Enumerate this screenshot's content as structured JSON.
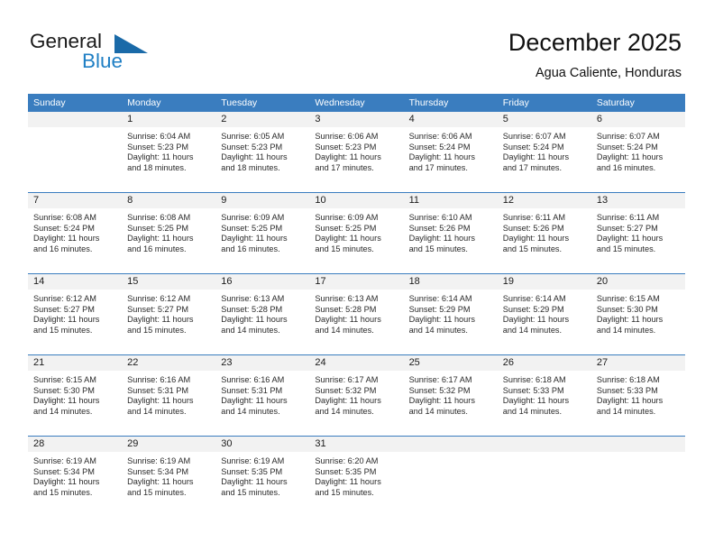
{
  "brand": {
    "word_one": "General",
    "word_two": "Blue",
    "triangle_icon": "triangle-logo-icon",
    "accent_color": "#1f7fc4",
    "triangle_color": "#1a6aa8"
  },
  "header": {
    "title": "December 2025",
    "subtitle": "Agua Caliente, Honduras"
  },
  "calendar": {
    "header_bg": "#3a7dbf",
    "daynum_bg": "#f2f2f2",
    "weekday_headers": [
      "Sunday",
      "Monday",
      "Tuesday",
      "Wednesday",
      "Thursday",
      "Friday",
      "Saturday"
    ],
    "weeks": [
      [
        {
          "day": "",
          "lines": []
        },
        {
          "day": "1",
          "lines": [
            "Sunrise: 6:04 AM",
            "Sunset: 5:23 PM",
            "Daylight: 11 hours",
            "and 18 minutes."
          ]
        },
        {
          "day": "2",
          "lines": [
            "Sunrise: 6:05 AM",
            "Sunset: 5:23 PM",
            "Daylight: 11 hours",
            "and 18 minutes."
          ]
        },
        {
          "day": "3",
          "lines": [
            "Sunrise: 6:06 AM",
            "Sunset: 5:23 PM",
            "Daylight: 11 hours",
            "and 17 minutes."
          ]
        },
        {
          "day": "4",
          "lines": [
            "Sunrise: 6:06 AM",
            "Sunset: 5:24 PM",
            "Daylight: 11 hours",
            "and 17 minutes."
          ]
        },
        {
          "day": "5",
          "lines": [
            "Sunrise: 6:07 AM",
            "Sunset: 5:24 PM",
            "Daylight: 11 hours",
            "and 17 minutes."
          ]
        },
        {
          "day": "6",
          "lines": [
            "Sunrise: 6:07 AM",
            "Sunset: 5:24 PM",
            "Daylight: 11 hours",
            "and 16 minutes."
          ]
        }
      ],
      [
        {
          "day": "7",
          "lines": [
            "Sunrise: 6:08 AM",
            "Sunset: 5:24 PM",
            "Daylight: 11 hours",
            "and 16 minutes."
          ]
        },
        {
          "day": "8",
          "lines": [
            "Sunrise: 6:08 AM",
            "Sunset: 5:25 PM",
            "Daylight: 11 hours",
            "and 16 minutes."
          ]
        },
        {
          "day": "9",
          "lines": [
            "Sunrise: 6:09 AM",
            "Sunset: 5:25 PM",
            "Daylight: 11 hours",
            "and 16 minutes."
          ]
        },
        {
          "day": "10",
          "lines": [
            "Sunrise: 6:09 AM",
            "Sunset: 5:25 PM",
            "Daylight: 11 hours",
            "and 15 minutes."
          ]
        },
        {
          "day": "11",
          "lines": [
            "Sunrise: 6:10 AM",
            "Sunset: 5:26 PM",
            "Daylight: 11 hours",
            "and 15 minutes."
          ]
        },
        {
          "day": "12",
          "lines": [
            "Sunrise: 6:11 AM",
            "Sunset: 5:26 PM",
            "Daylight: 11 hours",
            "and 15 minutes."
          ]
        },
        {
          "day": "13",
          "lines": [
            "Sunrise: 6:11 AM",
            "Sunset: 5:27 PM",
            "Daylight: 11 hours",
            "and 15 minutes."
          ]
        }
      ],
      [
        {
          "day": "14",
          "lines": [
            "Sunrise: 6:12 AM",
            "Sunset: 5:27 PM",
            "Daylight: 11 hours",
            "and 15 minutes."
          ]
        },
        {
          "day": "15",
          "lines": [
            "Sunrise: 6:12 AM",
            "Sunset: 5:27 PM",
            "Daylight: 11 hours",
            "and 15 minutes."
          ]
        },
        {
          "day": "16",
          "lines": [
            "Sunrise: 6:13 AM",
            "Sunset: 5:28 PM",
            "Daylight: 11 hours",
            "and 14 minutes."
          ]
        },
        {
          "day": "17",
          "lines": [
            "Sunrise: 6:13 AM",
            "Sunset: 5:28 PM",
            "Daylight: 11 hours",
            "and 14 minutes."
          ]
        },
        {
          "day": "18",
          "lines": [
            "Sunrise: 6:14 AM",
            "Sunset: 5:29 PM",
            "Daylight: 11 hours",
            "and 14 minutes."
          ]
        },
        {
          "day": "19",
          "lines": [
            "Sunrise: 6:14 AM",
            "Sunset: 5:29 PM",
            "Daylight: 11 hours",
            "and 14 minutes."
          ]
        },
        {
          "day": "20",
          "lines": [
            "Sunrise: 6:15 AM",
            "Sunset: 5:30 PM",
            "Daylight: 11 hours",
            "and 14 minutes."
          ]
        }
      ],
      [
        {
          "day": "21",
          "lines": [
            "Sunrise: 6:15 AM",
            "Sunset: 5:30 PM",
            "Daylight: 11 hours",
            "and 14 minutes."
          ]
        },
        {
          "day": "22",
          "lines": [
            "Sunrise: 6:16 AM",
            "Sunset: 5:31 PM",
            "Daylight: 11 hours",
            "and 14 minutes."
          ]
        },
        {
          "day": "23",
          "lines": [
            "Sunrise: 6:16 AM",
            "Sunset: 5:31 PM",
            "Daylight: 11 hours",
            "and 14 minutes."
          ]
        },
        {
          "day": "24",
          "lines": [
            "Sunrise: 6:17 AM",
            "Sunset: 5:32 PM",
            "Daylight: 11 hours",
            "and 14 minutes."
          ]
        },
        {
          "day": "25",
          "lines": [
            "Sunrise: 6:17 AM",
            "Sunset: 5:32 PM",
            "Daylight: 11 hours",
            "and 14 minutes."
          ]
        },
        {
          "day": "26",
          "lines": [
            "Sunrise: 6:18 AM",
            "Sunset: 5:33 PM",
            "Daylight: 11 hours",
            "and 14 minutes."
          ]
        },
        {
          "day": "27",
          "lines": [
            "Sunrise: 6:18 AM",
            "Sunset: 5:33 PM",
            "Daylight: 11 hours",
            "and 14 minutes."
          ]
        }
      ],
      [
        {
          "day": "28",
          "lines": [
            "Sunrise: 6:19 AM",
            "Sunset: 5:34 PM",
            "Daylight: 11 hours",
            "and 15 minutes."
          ]
        },
        {
          "day": "29",
          "lines": [
            "Sunrise: 6:19 AM",
            "Sunset: 5:34 PM",
            "Daylight: 11 hours",
            "and 15 minutes."
          ]
        },
        {
          "day": "30",
          "lines": [
            "Sunrise: 6:19 AM",
            "Sunset: 5:35 PM",
            "Daylight: 11 hours",
            "and 15 minutes."
          ]
        },
        {
          "day": "31",
          "lines": [
            "Sunrise: 6:20 AM",
            "Sunset: 5:35 PM",
            "Daylight: 11 hours",
            "and 15 minutes."
          ]
        },
        {
          "day": "",
          "lines": []
        },
        {
          "day": "",
          "lines": []
        },
        {
          "day": "",
          "lines": []
        }
      ]
    ]
  }
}
